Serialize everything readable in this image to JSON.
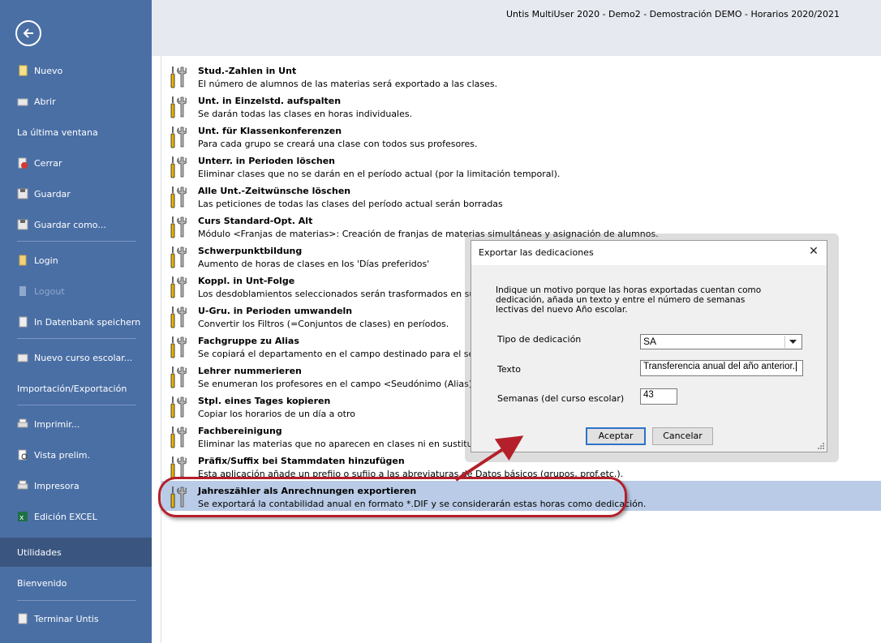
{
  "window": {
    "title": "Untis MultiUser 2020 - Demo2  -  Demostración  DEMO  -  Horarios 2020/2021"
  },
  "sidebar": {
    "items": [
      {
        "label": "Nuevo",
        "icon": "new-document-icon"
      },
      {
        "label": "Abrir",
        "icon": "open-icon"
      },
      {
        "label": "La última ventana",
        "icon": ""
      },
      {
        "label": "Cerrar",
        "icon": "close-document-icon"
      },
      {
        "label": "Guardar",
        "icon": "save-icon"
      },
      {
        "label": "Guardar como...",
        "icon": "save-as-icon"
      },
      {
        "label": "Login",
        "icon": "login-icon"
      },
      {
        "label": "Logout",
        "icon": "logout-icon"
      },
      {
        "label": "In Datenbank speichern",
        "icon": "database-save-icon"
      },
      {
        "label": "Nuevo curso escolar...",
        "icon": "new-school-year-icon"
      },
      {
        "label": "Importación/Exportación",
        "icon": ""
      },
      {
        "label": "Imprimir...",
        "icon": "print-icon"
      },
      {
        "label": "Vista prelim.",
        "icon": "print-preview-icon"
      },
      {
        "label": "Impresora",
        "icon": "printer-icon"
      },
      {
        "label": "Edición EXCEL",
        "icon": "excel-icon"
      },
      {
        "label": "Utilidades",
        "icon": ""
      },
      {
        "label": "Bienvenido",
        "icon": ""
      },
      {
        "label": "Terminar Untis",
        "icon": "exit-icon"
      }
    ]
  },
  "utilities": [
    {
      "title": "Stud.-Zahlen in Unt",
      "desc": "El número de alumnos de las materias será exportado a las clases."
    },
    {
      "title": "Unt. in Einzelstd. aufspalten",
      "desc": "Se darán todas las clases en horas individuales."
    },
    {
      "title": "Unt. für Klassenkonferenzen",
      "desc": "Para cada grupo se creará una clase con todos sus profesores."
    },
    {
      "title": "Unterr. in Perioden löschen",
      "desc": "Eliminar clases que no se darán en el período actual (por la limitación temporal)."
    },
    {
      "title": "Alle Unt.-Zeitwünsche löschen",
      "desc": "Las peticiones de todas las clases del período actual serán borradas"
    },
    {
      "title": "Curs Standard-Opt. Alt",
      "desc": "Módulo <Franjas de materias>: Creación de franjas de materias simultáneas y asignación de alumnos."
    },
    {
      "title": "Schwerpunktbildung",
      "desc": "Aumento de horas de clases en los 'Días preferidos'"
    },
    {
      "title": "Koppl. in Unt-Folge",
      "desc": "Los desdoblamientos seleccionados serán trasformados en sucesi"
    },
    {
      "title": "U-Gru. in Perioden umwandeln",
      "desc": "Convertir los Filtros (=Conjuntos de clases) en períodos."
    },
    {
      "title": "Fachgruppe zu Alias",
      "desc": "Se copiará el departamento en el campo destinado para el seudó"
    },
    {
      "title": "Lehrer nummerieren",
      "desc": "Se enumeran los profesores en el campo <Seudónimo (Alias)> po"
    },
    {
      "title": "Stpl. eines Tages kopieren",
      "desc": "Copiar los horarios de un día a otro"
    },
    {
      "title": "Fachbereinigung",
      "desc": "Eliminar las materias que no aparecen en clases ni en sustitucione"
    },
    {
      "title": "Präfix/Suffix bei Stammdaten hinzufügen",
      "desc": "Esta aplicación añade un prefijo o sufijo a las abreviaturas de Datos básicos (grupos, prof.etc.)."
    },
    {
      "title": "Jahreszähler als Anrechnungen exportieren",
      "desc": "Se exportará la contabilidad anual en formato *.DIF y se considerarán estas horas como dedicación."
    }
  ],
  "dialog": {
    "title": "Exportar las dedicaciones",
    "description": "Indique un motivo porque las horas exportadas cuentan como dedicación, añada un texto y entre el número de semanas lectivas del nuevo Año escolar.",
    "tipo_label": "Tipo de dedicación",
    "tipo_value": "SA",
    "texto_label": "Texto",
    "texto_value": "Transferencia anual del año anterior.",
    "semanas_label": "Semanas (del curso escolar)",
    "semanas_value": "43",
    "accept": "Aceptar",
    "cancel": "Cancelar",
    "close_glyph": "✕"
  },
  "colors": {
    "sidebar": "#4a6fa5",
    "selected_row": "#b9cbe6",
    "highlight": "#b4202a"
  }
}
